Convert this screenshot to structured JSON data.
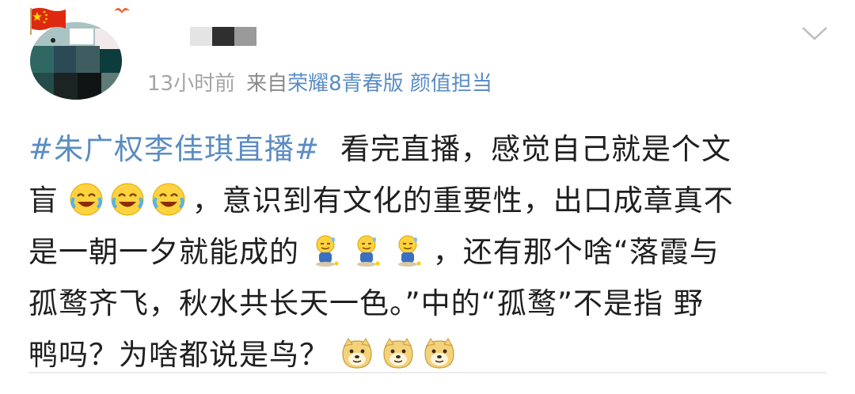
{
  "post": {
    "time_text": "13小时前",
    "source_prefix": "来自",
    "source_device": "荣耀8青春版 颜值担当",
    "hashtag": "#朱广权李佳琪直播#",
    "line1_text": "看完直播，感觉自己就是个文",
    "line2_lead": "盲",
    "line2_text": "，意识到有文化的重要性，出口成章真不",
    "line3_lead": "是一朝一夕就能成的",
    "line3_text": "，还有那个啥“落霞与",
    "line4_text": "孤鹜齐飞，秋水共长天一色。”中的“孤鹜”不是指 野",
    "line5_text": "鸭吗？为啥都说是鸟？"
  },
  "emoji": {
    "laugh_cry": "laugh-cry-emoji",
    "sweat_smile": "sweat-sitting-emoji",
    "doge": "doge-emoji"
  },
  "colors": {
    "link": "#5b8cc3",
    "meta": "#8a8a8a",
    "text": "#1f1f1f",
    "flag_red": "#de2910",
    "flag_yellow": "#ffde00"
  }
}
